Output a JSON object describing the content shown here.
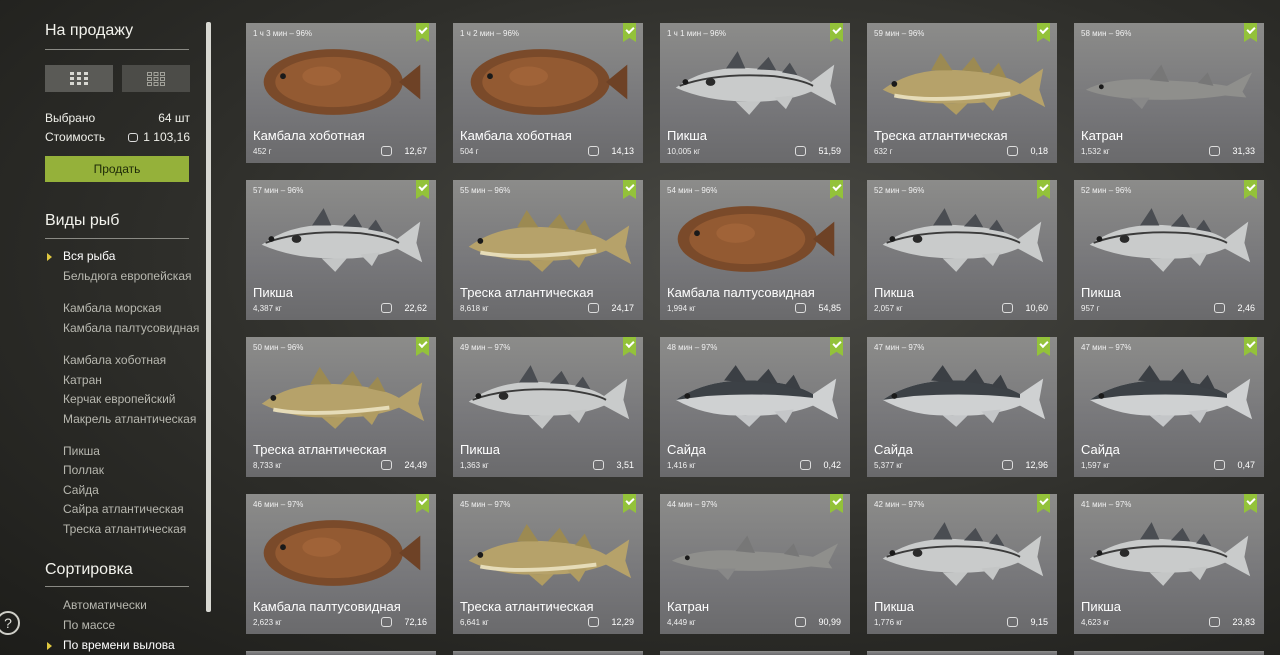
{
  "sidebar": {
    "for_sale_title": "На продажу",
    "selected_label": "Выбрано",
    "selected_value": "64 шт",
    "cost_label": "Стоимость",
    "cost_value": "1 103,16",
    "sell_button": "Продать",
    "species_title": "Виды рыб",
    "species": [
      {
        "label": "Вся рыба",
        "active": true
      },
      {
        "label": "Бельдюга европейская",
        "active": false
      },
      {
        "label": "Камбала морская",
        "active": false
      },
      {
        "label": "Камбала палтусовидная",
        "active": false
      },
      {
        "label": "Камбала хоботная",
        "active": false
      },
      {
        "label": "Катран",
        "active": false
      },
      {
        "label": "Керчак европейский",
        "active": false
      },
      {
        "label": "Макрель атлантическая",
        "active": false
      },
      {
        "label": "Пикша",
        "active": false
      },
      {
        "label": "Поллак",
        "active": false
      },
      {
        "label": "Сайда",
        "active": false
      },
      {
        "label": "Сайра атлантическая",
        "active": false
      },
      {
        "label": "Треска атлантическая",
        "active": false
      }
    ],
    "sort_title": "Сортировка",
    "sort_options": [
      {
        "label": "Автоматически",
        "active": false
      },
      {
        "label": "По массе",
        "active": false
      },
      {
        "label": "По времени вылова",
        "active": true
      }
    ],
    "help_icon": "?"
  },
  "cards": [
    {
      "time": "1 ч 3 мин – 96%",
      "name": "Камбала хоботная",
      "weight": "452 г",
      "price": "12,67",
      "fish": "flatfish"
    },
    {
      "time": "1 ч 2 мин – 96%",
      "name": "Камбала хоботная",
      "weight": "504 г",
      "price": "14,13",
      "fish": "flatfish"
    },
    {
      "time": "1 ч 1 мин – 96%",
      "name": "Пикша",
      "weight": "10,005 кг",
      "price": "51,59",
      "fish": "haddock"
    },
    {
      "time": "59 мин – 96%",
      "name": "Треска атлантическая",
      "weight": "632 г",
      "price": "0,18",
      "fish": "cod"
    },
    {
      "time": "58 мин – 96%",
      "name": "Катран",
      "weight": "1,532 кг",
      "price": "31,33",
      "fish": "shark"
    },
    {
      "time": "57 мин – 96%",
      "name": "Пикша",
      "weight": "4,387 кг",
      "price": "22,62",
      "fish": "haddock"
    },
    {
      "time": "55 мин – 96%",
      "name": "Треска атлантическая",
      "weight": "8,618 кг",
      "price": "24,17",
      "fish": "cod"
    },
    {
      "time": "54 мин – 96%",
      "name": "Камбала палтусовидная",
      "weight": "1,994 кг",
      "price": "54,85",
      "fish": "flatfish"
    },
    {
      "time": "52 мин – 96%",
      "name": "Пикша",
      "weight": "2,057 кг",
      "price": "10,60",
      "fish": "haddock"
    },
    {
      "time": "52 мин – 96%",
      "name": "Пикша",
      "weight": "957 г",
      "price": "2,46",
      "fish": "haddock"
    },
    {
      "time": "50 мин – 96%",
      "name": "Треска атлантическая",
      "weight": "8,733 кг",
      "price": "24,49",
      "fish": "cod"
    },
    {
      "time": "49 мин – 97%",
      "name": "Пикша",
      "weight": "1,363 кг",
      "price": "3,51",
      "fish": "haddock"
    },
    {
      "time": "48 мин – 97%",
      "name": "Сайда",
      "weight": "1,416 кг",
      "price": "0,42",
      "fish": "saithe"
    },
    {
      "time": "47 мин – 97%",
      "name": "Сайда",
      "weight": "5,377 кг",
      "price": "12,96",
      "fish": "saithe"
    },
    {
      "time": "47 мин – 97%",
      "name": "Сайда",
      "weight": "1,597 кг",
      "price": "0,47",
      "fish": "saithe"
    },
    {
      "time": "46 мин – 97%",
      "name": "Камбала палтусовидная",
      "weight": "2,623 кг",
      "price": "72,16",
      "fish": "flatfish"
    },
    {
      "time": "45 мин – 97%",
      "name": "Треска атлантическая",
      "weight": "6,641 кг",
      "price": "12,29",
      "fish": "cod"
    },
    {
      "time": "44 мин – 97%",
      "name": "Катран",
      "weight": "4,449 кг",
      "price": "90,99",
      "fish": "shark"
    },
    {
      "time": "42 мин – 97%",
      "name": "Пикша",
      "weight": "1,776 кг",
      "price": "9,15",
      "fish": "haddock"
    },
    {
      "time": "41 мин – 97%",
      "name": "Пикша",
      "weight": "4,623 кг",
      "price": "23,83",
      "fish": "haddock"
    }
  ],
  "colors": {
    "accent_green": "#95b13a",
    "check_green": "#93c23a",
    "active_arrow": "#e0c840"
  }
}
